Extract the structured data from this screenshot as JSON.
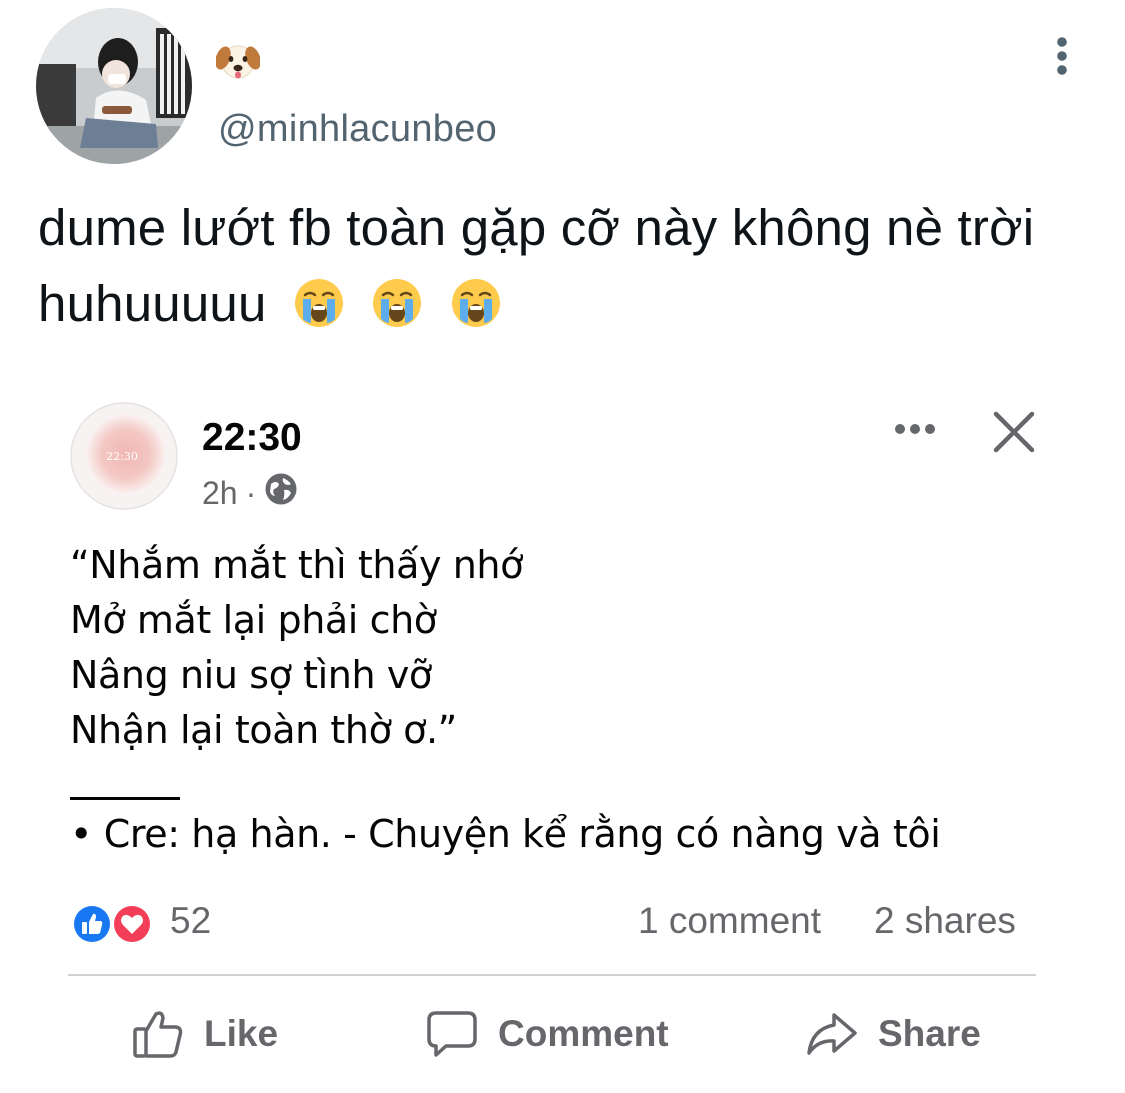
{
  "tweet": {
    "display_name_emoji": "dog-face-emoji",
    "handle": "@minhlacunbeo",
    "text": "dume lướt fb toàn gặp cỡ này không nè trời huhuuuuu",
    "trailing_emojis": [
      "loudly-crying-face",
      "loudly-crying-face",
      "loudly-crying-face"
    ],
    "menu_icon": "more-vertical-icon"
  },
  "fb_post": {
    "avatar_text": "22:30",
    "page_name": "22:30",
    "time": "2h",
    "separator": "·",
    "privacy_icon": "globe-icon",
    "body_lines": [
      "“Nhắm mắt thì thấy nhớ",
      "Mở mắt lại phải chờ",
      "Nâng niu sợ tình vỡ",
      "Nhận lại toàn thờ ơ.”"
    ],
    "credit": "• Cre: hạ hàn. - Chuyện kể rằng có nàng và tôi",
    "reaction_icons": [
      "like-reaction-icon",
      "love-reaction-icon"
    ],
    "reaction_count": "52",
    "comment_count": "1 comment",
    "share_count": "2 shares",
    "actions": {
      "like": "Like",
      "comment": "Comment",
      "share": "Share"
    }
  },
  "colors": {
    "handle_gray": "#536471",
    "fb_gray": "#65676b",
    "like_blue": "#1877f2",
    "love_red": "#f33e58"
  }
}
